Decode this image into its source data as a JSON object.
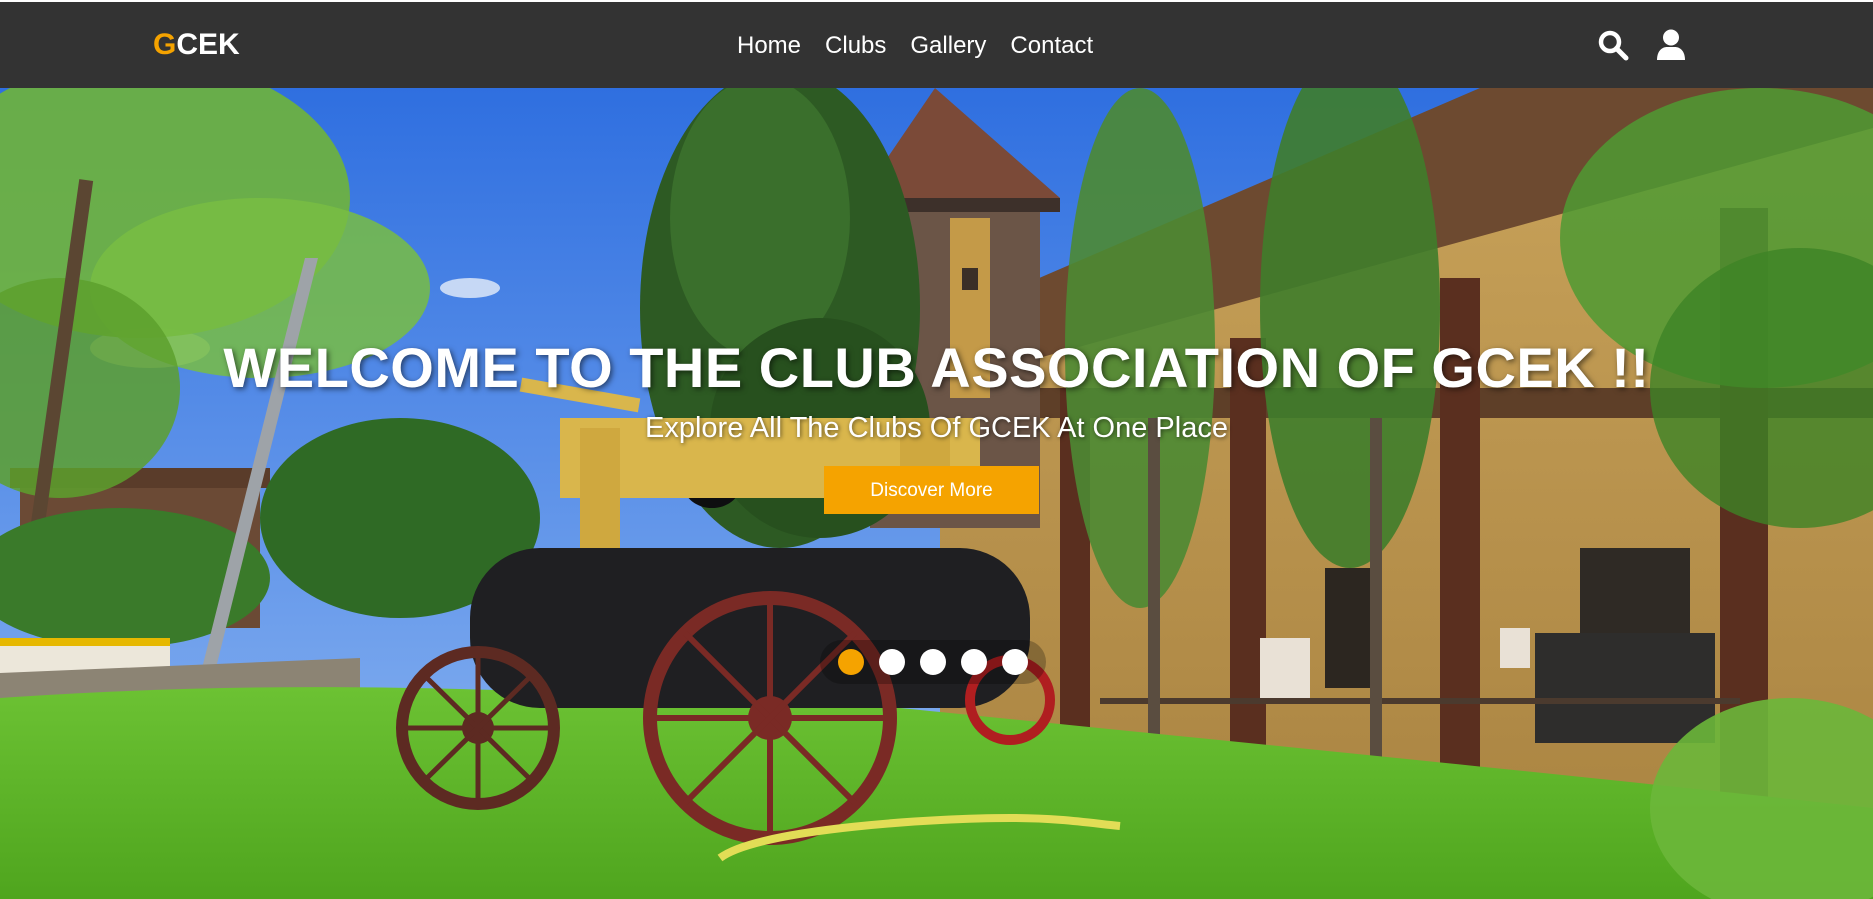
{
  "navbar": {
    "logo": {
      "accent": "G",
      "rest": "CEK"
    },
    "links": [
      "Home",
      "Clubs",
      "Gallery",
      "Contact"
    ],
    "icons": [
      "search-icon",
      "user-icon"
    ]
  },
  "hero": {
    "title": "WELCOME TO THE CLUB ASSOCIATION OF GCEK !!",
    "subtitle": "Explore All The Clubs Of GCEK At One Place",
    "cta_label": "Discover More",
    "carousel": {
      "slide_count": 5,
      "active_index": 0
    }
  },
  "colors": {
    "navbar_bg": "#333333",
    "accent": "#f5a300",
    "text": "#ffffff"
  }
}
